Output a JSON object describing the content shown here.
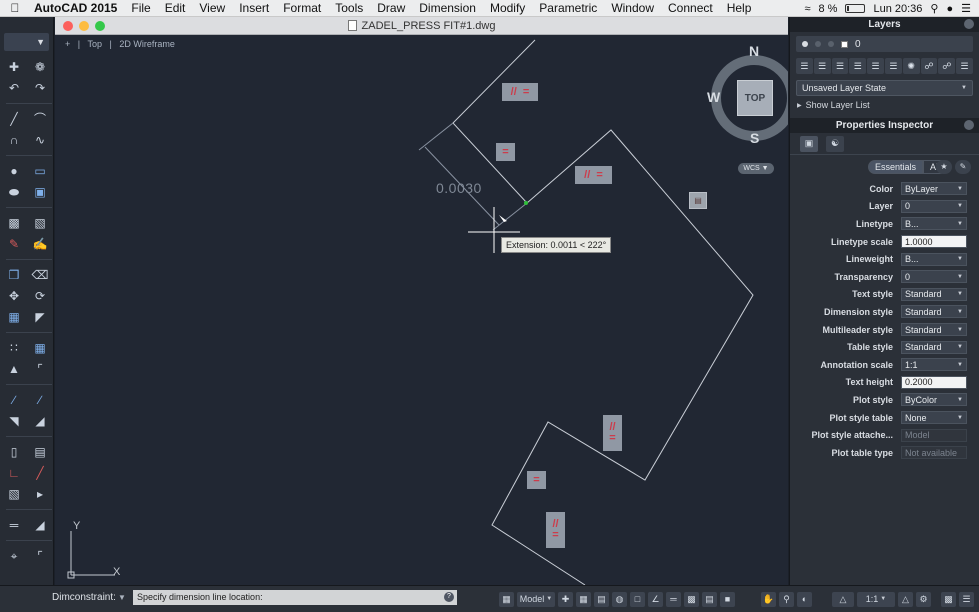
{
  "menubar": {
    "app": "AutoCAD 2015",
    "items": [
      "File",
      "Edit",
      "View",
      "Insert",
      "Format",
      "Tools",
      "Draw",
      "Dimension",
      "Modify",
      "Parametric",
      "Window",
      "Connect",
      "Help"
    ],
    "battery": "8 %",
    "clock": "Lun 20:36"
  },
  "window": {
    "title": "ZADEL_PRESS FIT#1.dwg"
  },
  "viewport": {
    "plus": "+",
    "view": "Top",
    "style": "2D Wireframe"
  },
  "viewcube": {
    "north": "N",
    "south": "S",
    "west": "W",
    "face": "TOP",
    "wcs": "WCS"
  },
  "dimension": {
    "value": "0.0030"
  },
  "tooltip": {
    "text": "Extension: 0.0011 < 222°"
  },
  "ucs": {
    "x": "X",
    "y": "Y"
  },
  "layers": {
    "title": "Layers",
    "current": "0",
    "state": "Unsaved Layer State",
    "show_list": "Show Layer List"
  },
  "properties": {
    "title": "Properties Inspector",
    "tab_essentials": "Essentials",
    "tab_all": "All",
    "rows": [
      {
        "label": "Color",
        "value": "ByLayer",
        "kind": "dd"
      },
      {
        "label": "Layer",
        "value": "0",
        "kind": "dd"
      },
      {
        "label": "Linetype",
        "value": "B...",
        "kind": "dd"
      },
      {
        "label": "Linetype scale",
        "value": "1.0000",
        "kind": "light"
      },
      {
        "label": "Lineweight",
        "value": "B...",
        "kind": "dd"
      },
      {
        "label": "Transparency",
        "value": "0",
        "kind": "dd"
      },
      {
        "label": "Text style",
        "value": "Standard",
        "kind": "dd"
      },
      {
        "label": "Dimension style",
        "value": "Standard",
        "kind": "dd"
      },
      {
        "label": "Multileader style",
        "value": "Standard",
        "kind": "dd"
      },
      {
        "label": "Table style",
        "value": "Standard",
        "kind": "dd"
      },
      {
        "label": "Annotation scale",
        "value": "1:1",
        "kind": "dd"
      },
      {
        "label": "Text height",
        "value": "0.2000",
        "kind": "light"
      },
      {
        "label": "Plot style",
        "value": "ByColor",
        "kind": "dd"
      },
      {
        "label": "Plot style table",
        "value": "None",
        "kind": "dd"
      },
      {
        "label": "Plot style attache...",
        "value": "Model",
        "kind": "dis"
      },
      {
        "label": "Plot table type",
        "value": "Not available",
        "kind": "dis"
      }
    ]
  },
  "command": {
    "label": "Dimconstraint:",
    "prompt": "Specify dimension line location:",
    "help": "?"
  },
  "status": {
    "model": "Model",
    "scale": "1:1"
  }
}
